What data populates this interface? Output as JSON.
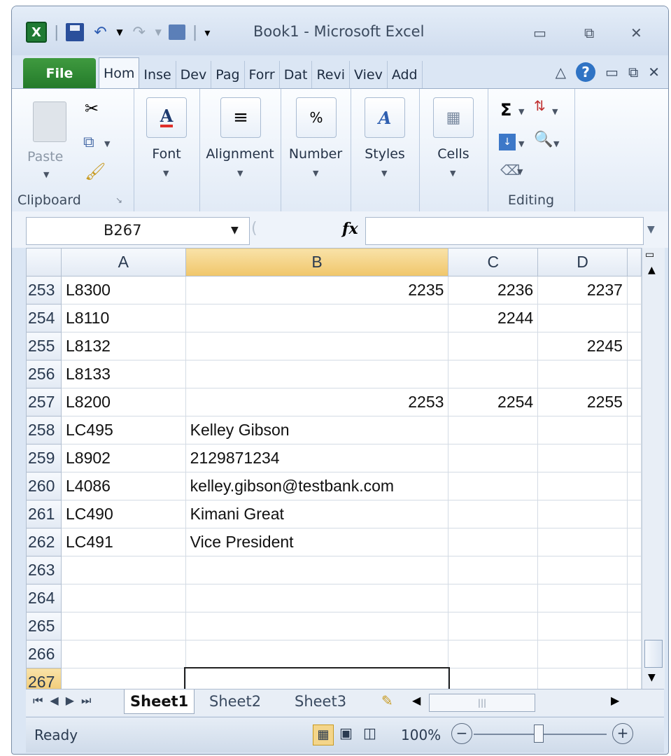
{
  "window": {
    "title": "Book1  -  Microsoft Excel",
    "controls": {
      "minimize": "▭",
      "restore": "⧉",
      "close": "✕"
    }
  },
  "quick_access": {
    "logo": "X",
    "undo": "↶",
    "redo": "↷",
    "customize": "▾"
  },
  "ribbon_tabs": [
    "File",
    "Hom",
    "Inse",
    "Dev",
    "Pag",
    "Forr",
    "Dat",
    "Revi",
    "Viev",
    "Add"
  ],
  "active_tab": "Hom",
  "ribbon": {
    "clipboard": {
      "paste_label": "Paste",
      "group_label": "Clipboard"
    },
    "font": {
      "label": "Font"
    },
    "alignment": {
      "label": "Alignment"
    },
    "number": {
      "label": "Number",
      "icon_text": "%"
    },
    "styles": {
      "label": "Styles"
    },
    "cells": {
      "label": "Cells"
    },
    "editing": {
      "group_label": "Editing"
    }
  },
  "formula_bar": {
    "name_box": "B267",
    "fx": "fx",
    "formula": ""
  },
  "columns": [
    "A",
    "B",
    "C",
    "D"
  ],
  "rows": [
    {
      "num": "253",
      "A": "L8300",
      "B": "2235",
      "C": "2236",
      "D": "2237"
    },
    {
      "num": "254",
      "A": "L8110",
      "B": "",
      "C": "2244",
      "D": ""
    },
    {
      "num": "255",
      "A": "L8132",
      "B": "",
      "C": "",
      "D": "2245"
    },
    {
      "num": "256",
      "A": "L8133",
      "B": "",
      "C": "",
      "D": ""
    },
    {
      "num": "257",
      "A": "L8200",
      "B": "2253",
      "C": "2254",
      "D": "2255"
    },
    {
      "num": "258",
      "A": "LC495",
      "B": "Kelley Gibson",
      "C": "",
      "D": ""
    },
    {
      "num": "259",
      "A": "L8902",
      "B": "2129871234",
      "C": "",
      "D": ""
    },
    {
      "num": "260",
      "A": "L4086",
      "B": "kelley.gibson@testbank.com",
      "C": "",
      "D": ""
    },
    {
      "num": "261",
      "A": "LC490",
      "B": "Kimani Great",
      "C": "",
      "D": ""
    },
    {
      "num": "262",
      "A": "LC491",
      "B": "Vice President",
      "C": "",
      "D": ""
    },
    {
      "num": "263",
      "A": "",
      "B": "",
      "C": "",
      "D": ""
    },
    {
      "num": "264",
      "A": "",
      "B": "",
      "C": "",
      "D": ""
    },
    {
      "num": "265",
      "A": "",
      "B": "",
      "C": "",
      "D": ""
    },
    {
      "num": "266",
      "A": "",
      "B": "",
      "C": "",
      "D": ""
    },
    {
      "num": "267",
      "A": "",
      "B": "",
      "C": "",
      "D": ""
    }
  ],
  "numeric_cells_right_aligned": [
    "B253",
    "C253",
    "D253",
    "C254",
    "D255",
    "B257",
    "C257",
    "D257"
  ],
  "sheet_tabs": [
    "Sheet1",
    "Sheet2",
    "Sheet3"
  ],
  "active_sheet": "Sheet1",
  "status": {
    "ready": "Ready",
    "zoom": "100%"
  },
  "colors": {
    "file_tab": "#2e8b35",
    "help": "#2f73c4",
    "selected_header": "#f0c66a"
  }
}
